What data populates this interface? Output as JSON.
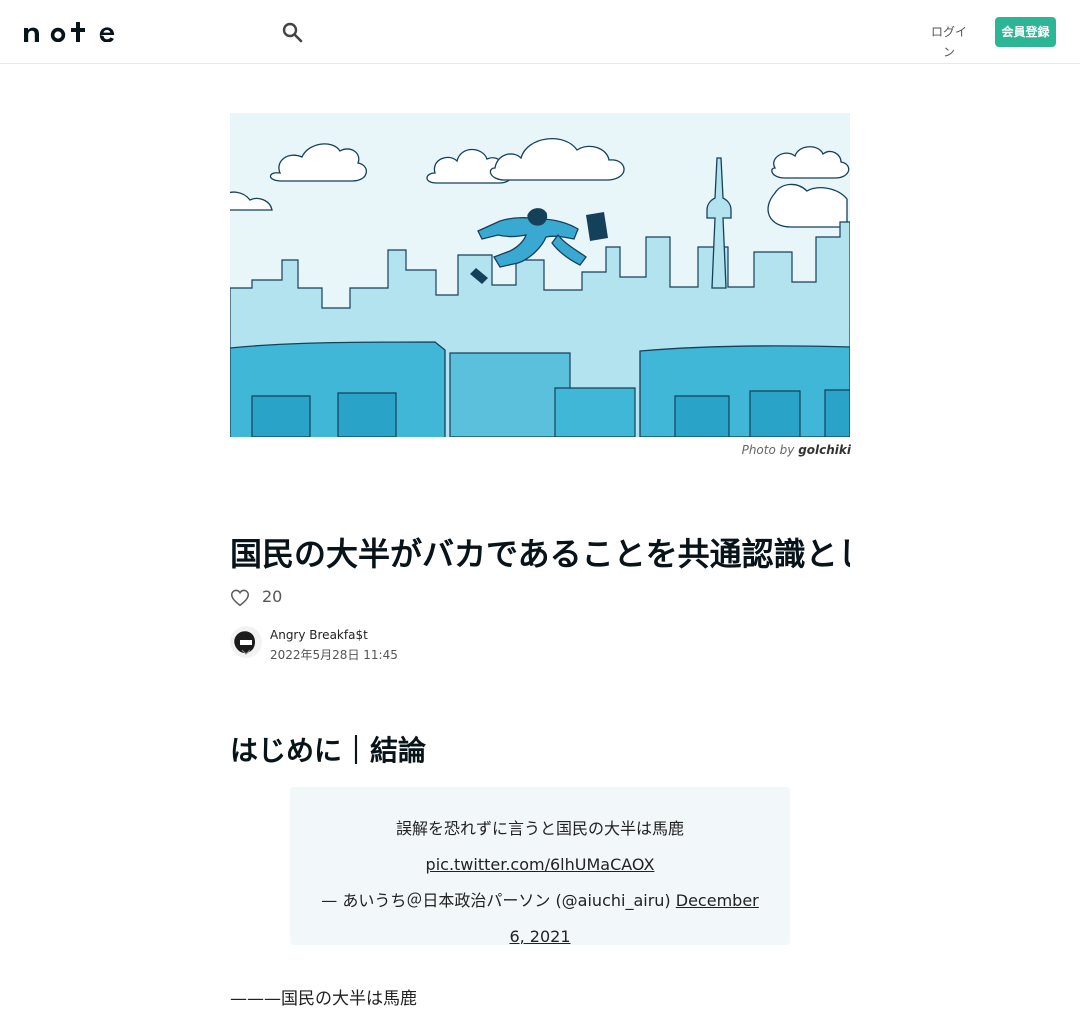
{
  "header": {
    "logo": "note",
    "login_label": "ログイン",
    "signup_label": "会員登録",
    "brand_color": "#2cb696"
  },
  "article": {
    "credit_prefix": "Photo by",
    "credit_author": "golchiki",
    "title": "国民の大半がバカであることを共通認識として民主主義を考える",
    "like_count": "20",
    "author": "Angry Breakfa$t",
    "date": "2022年5月28日 11:45",
    "section_heading": "はじめに｜結論",
    "tweet": {
      "text": "誤解を恐れずに言うと国民の大半は馬鹿",
      "link": "pic.twitter.com/6lhUMaCAOX",
      "attribution": "— あいうち＠日本政治パーソン (@aiuchi_airu)",
      "date": "December 6, 2021"
    },
    "body_start": "———国民の大半は馬鹿"
  }
}
